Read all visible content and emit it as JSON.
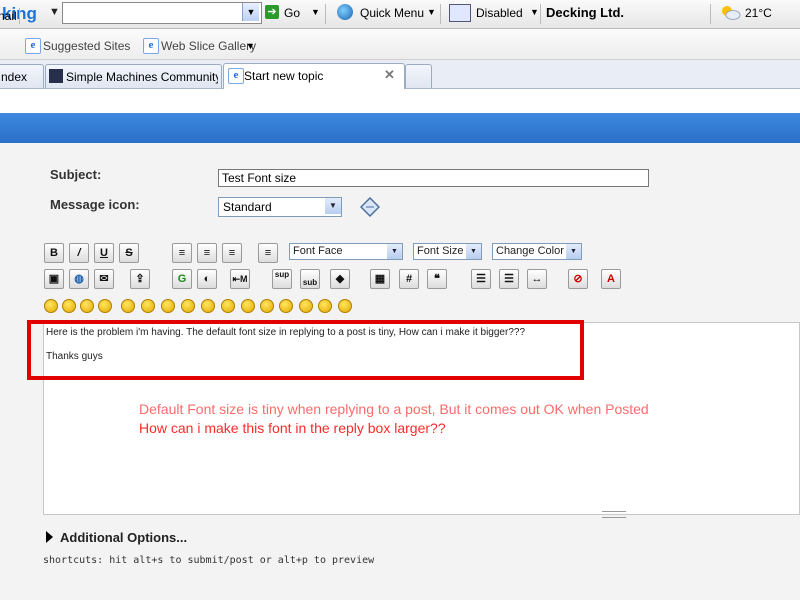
{
  "toolbar": {
    "brand": "king",
    "go_label": "Go",
    "quick_menu_label": "Quick Menu",
    "disabled_label": "Disabled",
    "company": "Decking Ltd.",
    "weather": "21°C"
  },
  "favorites": {
    "mail_label": "nail",
    "items": [
      {
        "label": "Suggested Sites"
      },
      {
        "label": "Web Slice Gallery"
      }
    ]
  },
  "tabs": [
    {
      "label": "ndex"
    },
    {
      "label": "Simple Machines Community ..."
    },
    {
      "label": "Start new topic"
    }
  ],
  "form": {
    "subject_label": "Subject:",
    "subject_value": "Test Font size",
    "message_icon_label": "Message icon:",
    "message_icon_value": "Standard"
  },
  "editor_toolbar": {
    "font_face": "Font Face",
    "font_size": "Font Size",
    "change_color": "Change Color"
  },
  "editor": {
    "line1": "Here is the problem i'm having. The default font size in replying to a post is tiny, How can i make it bigger???",
    "line2": "Thanks guys"
  },
  "annotations": {
    "line1": "Default Font size is tiny when replying to a post, But it comes out OK when Posted",
    "line2": "How can i make this font in the reply box larger??"
  },
  "additional_options": "Additional Options...",
  "shortcuts": "shortcuts: hit alt+s to submit/post or alt+p to preview",
  "colors": {
    "header_blue": "#2a6fc8",
    "annotation_red": "#e00000"
  }
}
